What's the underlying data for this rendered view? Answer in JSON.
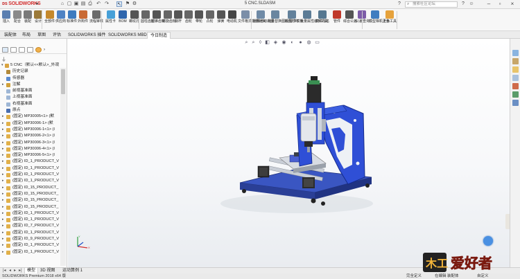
{
  "title_bar": {
    "logo_text": "SOLIDWORKS",
    "document_title": "5 CNC.SLDASM",
    "search_placeholder": "搜索社区论坛"
  },
  "ribbon": {
    "buttons": [
      {
        "label": "插入",
        "color": "#5b7fb0"
      },
      {
        "label": "配合",
        "color": "#8a8a8a"
      },
      {
        "label": "装配",
        "color": "#7a7a7a"
      },
      {
        "label": "设计",
        "color": "#9b7a3a"
      },
      {
        "label": "全部件",
        "color": "#c5892c"
      },
      {
        "label": "供应商",
        "color": "#4f83c4"
      },
      {
        "label": "标准件",
        "color": "#3e7bbf"
      },
      {
        "label": "外购件",
        "color": "#c96a35"
      },
      {
        "label": "流程审核",
        "color": "#6a6a6a"
      },
      {
        "label": "属性卡",
        "color": "#47a0d8"
      },
      {
        "label": "BOM",
        "color": "#2f66ad"
      },
      {
        "label": "螺纹孔",
        "color": "#555555"
      },
      {
        "label": "圆柱齿轮",
        "color": "#666666"
      },
      {
        "label": "圆锥齿轮",
        "color": "#555555"
      },
      {
        "label": "螺旋齿轮",
        "color": "#666666"
      },
      {
        "label": "蜗杆",
        "color": "#555555"
      },
      {
        "label": "齿轮",
        "color": "#666666"
      },
      {
        "label": "带轮",
        "color": "#555555"
      },
      {
        "label": "凸轮",
        "color": "#666666"
      },
      {
        "label": "弹簧",
        "color": "#555555"
      },
      {
        "label": "电动机",
        "color": "#444444"
      },
      {
        "label": "文件格式批量转换",
        "color": "#7b8ea8"
      },
      {
        "label": "批量自动出图",
        "color": "#6f8aa6"
      },
      {
        "label": "批量替换图纸/零件模板",
        "color": "#6a86a0"
      },
      {
        "label": "拆图打印",
        "color": "#63819b"
      },
      {
        "label": "批量属性编辑工具",
        "color": "#5c7c96"
      },
      {
        "label": "文件改名",
        "color": "#567891"
      },
      {
        "label": "管件",
        "color": "#c0392b"
      },
      {
        "label": "综合公差",
        "color": "#555555"
      },
      {
        "label": "公差查询",
        "color": "#7d5ca8"
      },
      {
        "label": "模型相机上色",
        "color": "#3f7dc0"
      },
      {
        "label": "更多工具",
        "color": "#e6a23c"
      }
    ]
  },
  "tabs": [
    {
      "label": "装配体",
      "active": false
    },
    {
      "label": "布局",
      "active": false
    },
    {
      "label": "草图",
      "active": false
    },
    {
      "label": "评估",
      "active": false
    },
    {
      "label": "SOLIDWORKS 插件",
      "active": false
    },
    {
      "label": "SOLIDWORKS MBD",
      "active": false
    },
    {
      "label": "今日制造",
      "active": true
    }
  ],
  "feature_tree": {
    "root": "5 CNC（默认<<默认>_外观",
    "items": [
      {
        "text": "历史记录",
        "icon": "history",
        "caret": false
      },
      {
        "text": "传感器",
        "icon": "sensor",
        "caret": false
      },
      {
        "text": "注解",
        "icon": "annotation",
        "caret": true
      },
      {
        "text": "前视基准面",
        "icon": "plane",
        "caret": false
      },
      {
        "text": "上视基准面",
        "icon": "plane",
        "caret": false
      },
      {
        "text": "右视基准面",
        "icon": "plane",
        "caret": false
      },
      {
        "text": "原点",
        "icon": "origin",
        "caret": false
      },
      {
        "text": "(固定) MP30005<1> (默",
        "icon": "part",
        "caret": true
      },
      {
        "text": "(固定) MP30006-1> (默",
        "icon": "part",
        "caret": true
      },
      {
        "text": "(固定) MP30006-1<1> (I",
        "icon": "part",
        "caret": true
      },
      {
        "text": "(固定) MP30006-2<1> (I",
        "icon": "part",
        "caret": true
      },
      {
        "text": "(固定) MP30006-3<1> (I",
        "icon": "part",
        "caret": true
      },
      {
        "text": "(固定) MP30006-4<1> (I",
        "icon": "part",
        "caret": true
      },
      {
        "text": "(固定) MP30006-5<1> (I",
        "icon": "part",
        "caret": true
      },
      {
        "text": "(固定) ID_1_PRODUCT_V",
        "icon": "part",
        "caret": true
      },
      {
        "text": "(固定) ID_1_PRODUCT_V",
        "icon": "part",
        "caret": true
      },
      {
        "text": "(固定) ID_1_PRODUCT_V",
        "icon": "part",
        "caret": true
      },
      {
        "text": "(固定) ID_1_PRODUCT_V",
        "icon": "part",
        "caret": true
      },
      {
        "text": "(固定) ID_15_PRODUCT_",
        "icon": "part",
        "caret": true
      },
      {
        "text": "(固定) ID_15_PRODUCT_",
        "icon": "part",
        "caret": true
      },
      {
        "text": "(固定) ID_15_PRODUCT_",
        "icon": "part",
        "caret": true
      },
      {
        "text": "(固定) ID_15_PRODUCT_",
        "icon": "part",
        "caret": true
      },
      {
        "text": "(固定) ID_1_PRODUCT_V",
        "icon": "part",
        "caret": true
      },
      {
        "text": "(固定) ID_1_PRODUCT_V",
        "icon": "part",
        "caret": true
      },
      {
        "text": "(固定) ID_7_PRODUCT_V",
        "icon": "part",
        "caret": true
      },
      {
        "text": "(固定) ID_1_PRODUCT_V",
        "icon": "part",
        "caret": true
      },
      {
        "text": "(固定) ID_9_PRODUCT_V",
        "icon": "part",
        "caret": true
      },
      {
        "text": "(固定) ID_1_PRODUCT_V",
        "icon": "part",
        "caret": true
      },
      {
        "text": "(固定) ID_1_PRODUCT_V",
        "icon": "part",
        "caret": true
      }
    ]
  },
  "bottom_tabs": [
    {
      "label": "模型",
      "active": true
    },
    {
      "label": "3D 视图",
      "active": false
    },
    {
      "label": "运动算例 1",
      "active": false
    }
  ],
  "status_bar": {
    "product": "SOLIDWORKS Premium 2018 x64 版",
    "state": "完全定义",
    "editing": "在编辑 装配体",
    "units": "自定义"
  },
  "watermark": {
    "text": "爱好者",
    "badge": "木工"
  }
}
